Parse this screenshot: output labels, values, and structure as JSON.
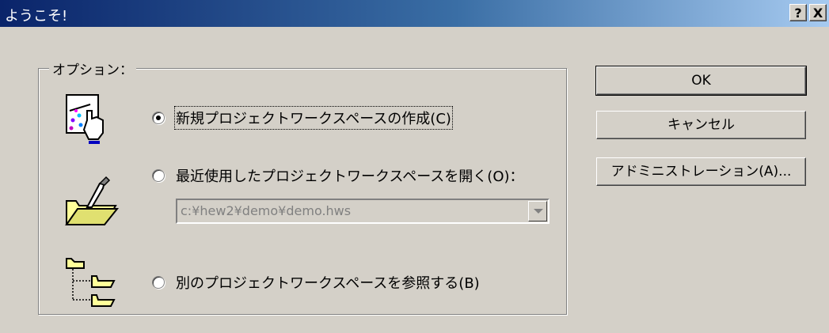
{
  "window": {
    "title": "ようこそ!",
    "help_button": "?",
    "close_button": "X"
  },
  "options": {
    "group_label": "オプション：",
    "new_workspace": {
      "label": "新規プロジェクトワークスペースの作成(C)",
      "checked": true
    },
    "open_recent": {
      "label": "最近使用したプロジェクトワークスペースを開く(O)：",
      "checked": false
    },
    "recent_path": "c:¥hew2¥demo¥demo.hws",
    "browse": {
      "label": "別のプロジェクトワークスペースを参照する(B)",
      "checked": false
    }
  },
  "buttons": {
    "ok": "OK",
    "cancel": "キャンセル",
    "admin": "アドミニストレーション(A)..."
  },
  "icons": {
    "new_workspace": "new-document-wand-icon",
    "open_recent": "open-folder-icon",
    "browse": "folder-tree-icon"
  }
}
